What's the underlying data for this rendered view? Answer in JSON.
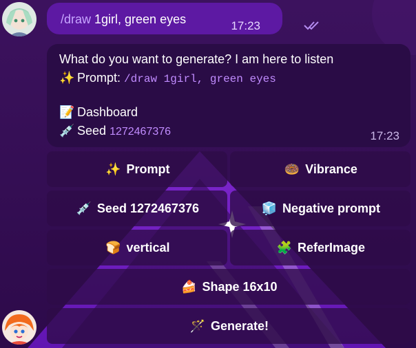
{
  "outgoing": {
    "command": "/draw",
    "text": " 1girl, green eyes",
    "time": "17:23"
  },
  "incoming": {
    "question": "What do you want to generate? I am here to listen",
    "prompt_label": "Prompt:",
    "prompt_value": "/draw 1girl, green eyes",
    "dashboard_label": "Dashboard",
    "seed_label": "Seed",
    "seed_value": "1272467376",
    "time": "17:23"
  },
  "keyboard": {
    "prompt": "Prompt",
    "vibrance": "Vibrance",
    "seed": "Seed 1272467376",
    "negative_prompt": "Negative prompt",
    "vertical": "vertical",
    "refer_image": "ReferImage",
    "shape": "Shape 16x10",
    "generate": "Generate!"
  },
  "icons": {
    "sparkles": "✨",
    "memo": "📝",
    "syringe": "💉",
    "donut": "🍩",
    "ice": "🧊",
    "bread": "🍞",
    "puzzle": "🧩",
    "cake": "🍰",
    "wand": "🪄"
  },
  "colors": {
    "accent": "#c18cff",
    "outgoing_bubble": "#5d19a3",
    "incoming_bubble": "#2a0c46"
  }
}
